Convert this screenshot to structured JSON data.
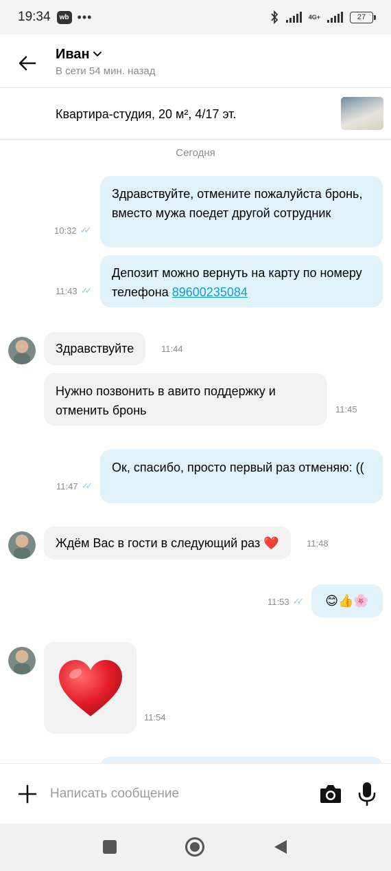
{
  "status_bar": {
    "time": "19:34",
    "app_badge": "wb",
    "more": "•••",
    "network": "4G+",
    "battery": "27"
  },
  "header": {
    "contact_name": "Иван",
    "last_seen": "В сети 54 мин. назад"
  },
  "listing": {
    "title": "Квартира-студия, 20 м², 4/17 эт."
  },
  "chat": {
    "date_separator": "Сегодня",
    "messages": [
      {
        "direction": "out",
        "text": "Здравствуйте, отмените пожалуйста бронь, вместо мужа поедет другой сотрудник",
        "time": "10:32",
        "read": true
      },
      {
        "direction": "out",
        "text_before_link": "Депозит можно вернуть на карту по номеру телефона ",
        "link": "89600235084",
        "time": "11:43",
        "read": true
      },
      {
        "direction": "in",
        "text": "Здравствуйте",
        "time": "11:44"
      },
      {
        "direction": "in",
        "text": "Нужно позвонить в авито поддержку и отменить бронь",
        "time": "11:45"
      },
      {
        "direction": "out",
        "text": "Ок, спасибо, просто первый раз отменяю: ((",
        "time": "11:47",
        "read": true
      },
      {
        "direction": "in",
        "text": "Ждём Вас в гости в следующий раз ❤️",
        "time": "11:48"
      },
      {
        "direction": "out",
        "text": "😊👍🌸",
        "time": "11:53",
        "read": true
      },
      {
        "direction": "in",
        "sticker": "heart",
        "time": "11:54"
      }
    ]
  },
  "composer": {
    "placeholder": "Написать сообщение"
  },
  "icons": {
    "back": "arrow-left-icon",
    "chevron": "chevron-down-icon",
    "attach": "plus-icon",
    "camera": "camera-icon",
    "mic": "microphone-icon"
  },
  "colors": {
    "outgoing_bubble": "#e2f2fb",
    "incoming_bubble": "#f2f2f2",
    "link": "#0a9fd6",
    "read_ticks": "#8ccbe9"
  }
}
